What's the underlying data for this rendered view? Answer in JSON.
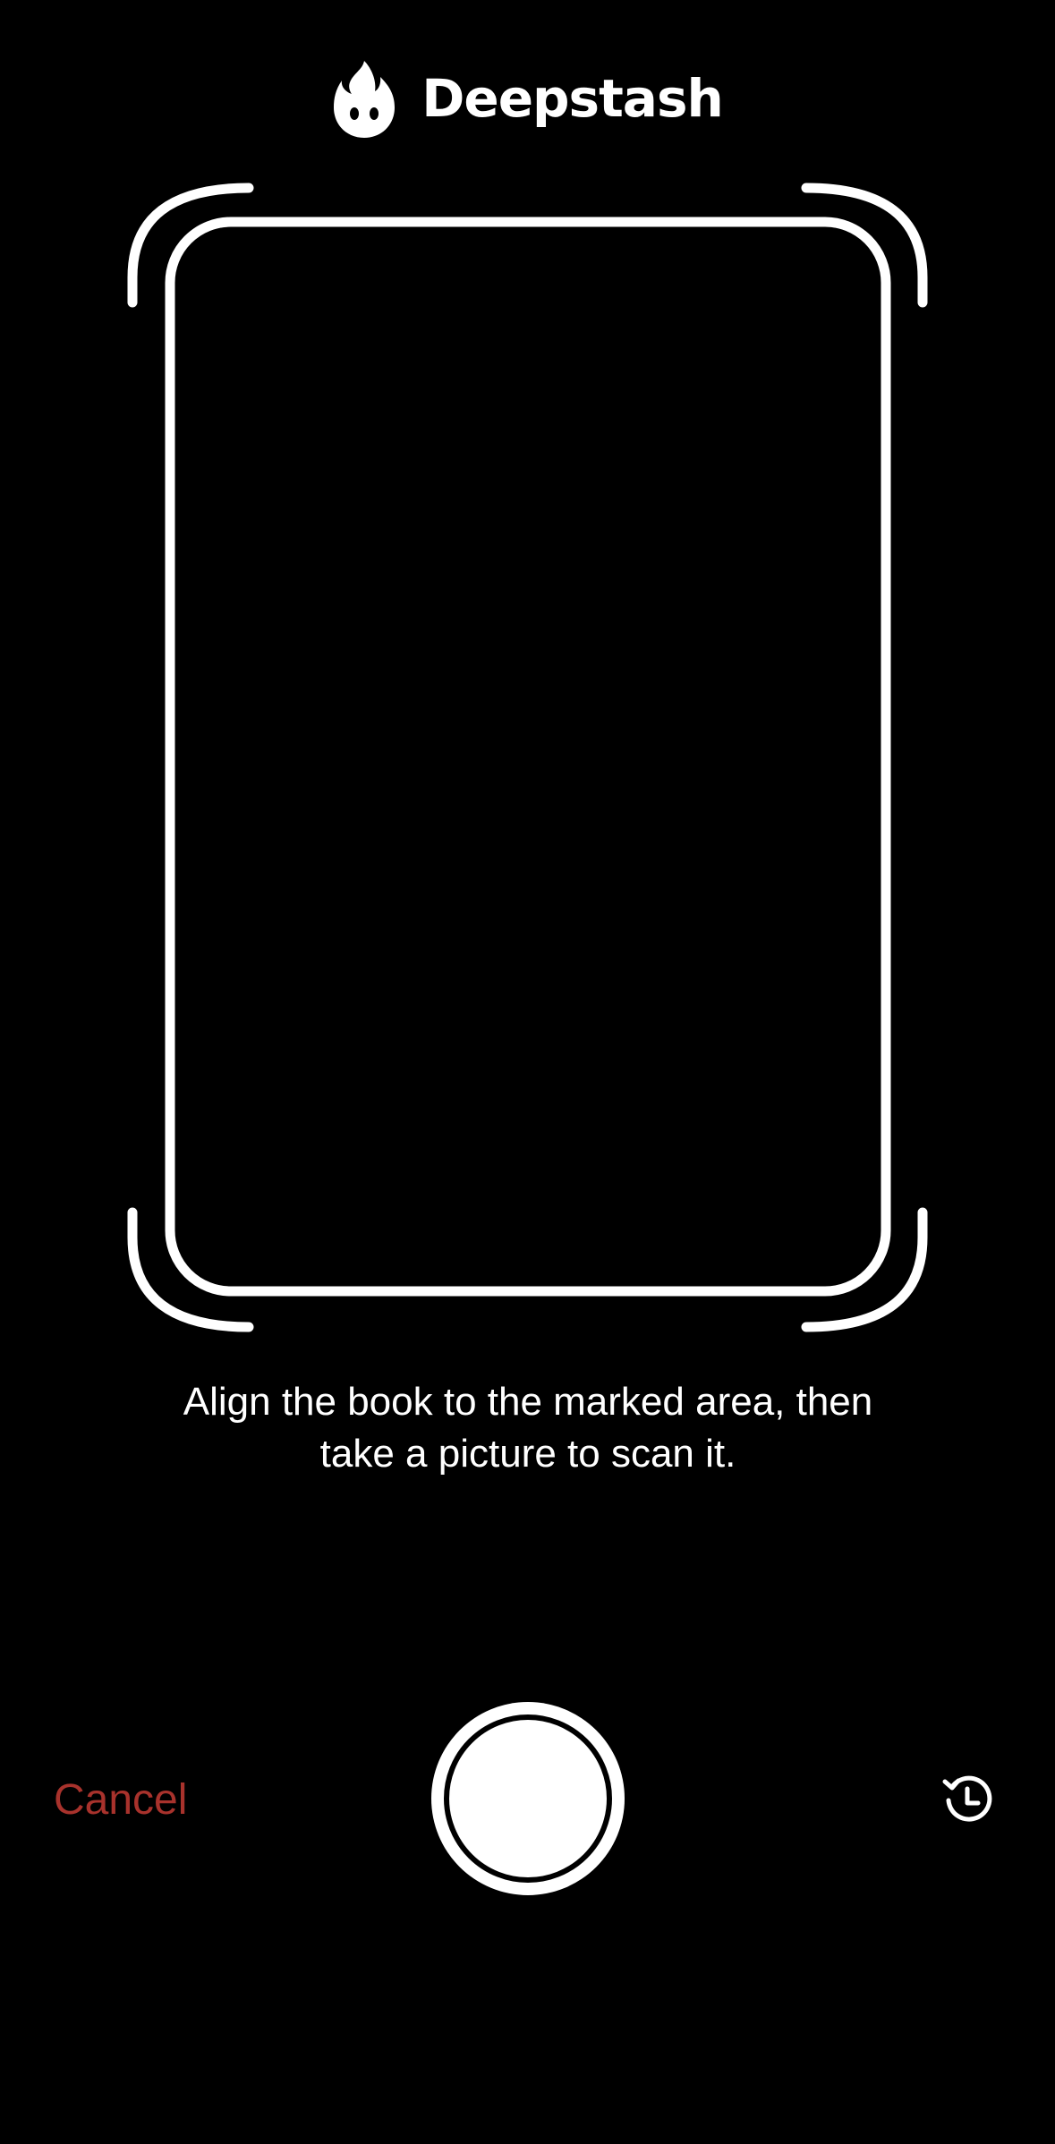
{
  "header": {
    "brand_name": "Deepstash",
    "logo_icon": "flame-logo-icon"
  },
  "scanner": {
    "instruction_line1": "Align the book to the marked area, then",
    "instruction_line2": "take a picture to scan it."
  },
  "controls": {
    "cancel_label": "Cancel",
    "shutter_icon": "shutter-button-icon",
    "history_icon": "history-clock-icon"
  },
  "colors": {
    "background": "#000000",
    "foreground": "#ffffff",
    "cancel_accent": "#a8322c"
  }
}
